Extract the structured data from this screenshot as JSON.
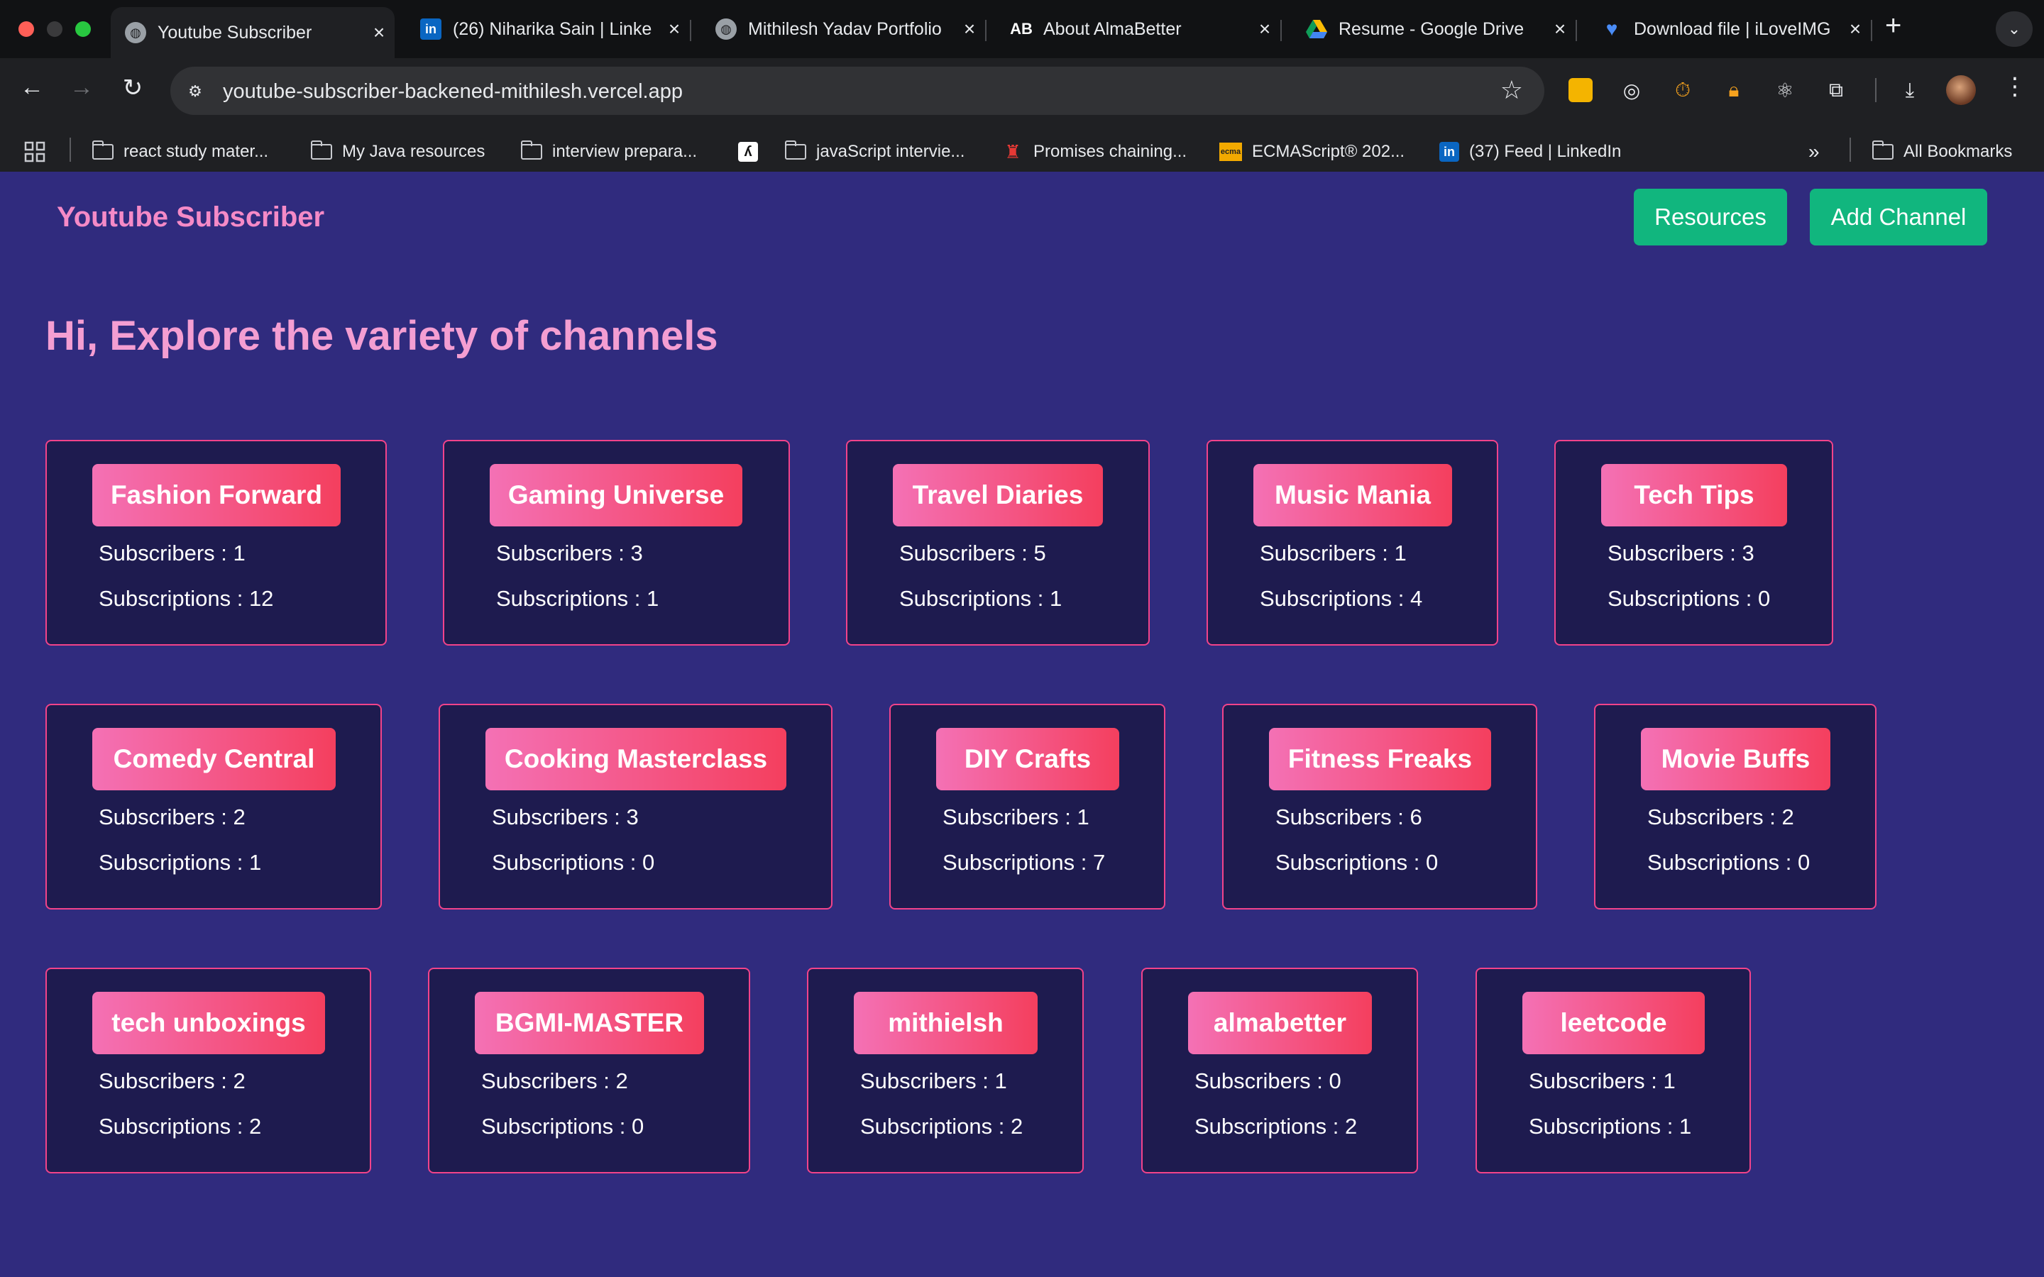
{
  "browser": {
    "tabs": [
      {
        "title": "Youtube Subscriber",
        "icon": "globe-icon"
      },
      {
        "title": "(26) Niharika Sain | Linke",
        "icon": "linkedin-icon"
      },
      {
        "title": "Mithilesh Yadav Portfolio",
        "icon": "globe-icon"
      },
      {
        "title": "About AlmaBetter",
        "icon": "almabetter-icon"
      },
      {
        "title": "Resume - Google Drive",
        "icon": "google-drive-icon"
      },
      {
        "title": "Download file | iLoveIMG",
        "icon": "heart-icon"
      }
    ],
    "url": "youtube-subscriber-backened-mithilesh.vercel.app",
    "bookmarks": [
      {
        "label": "react study mater...",
        "icon": "folder-icon"
      },
      {
        "label": "My Java resources",
        "icon": "folder-icon"
      },
      {
        "label": "interview prepara...",
        "icon": "folder-icon"
      },
      {
        "label": "",
        "icon": "bookmark-logo-icon"
      },
      {
        "label": "javaScript intervie...",
        "icon": "folder-icon"
      },
      {
        "label": "Promises chaining...",
        "icon": "tower-icon"
      },
      {
        "label": "ECMAScript® 202...",
        "icon": "ecma-icon"
      },
      {
        "label": "(37) Feed | LinkedIn",
        "icon": "linkedin-icon"
      }
    ],
    "more_bookmarks": "»",
    "all_bookmarks": "All Bookmarks"
  },
  "app": {
    "brand": "Youtube Subscriber",
    "resources_button": "Resources",
    "add_channel_button": "Add Channel",
    "heading": "Hi, Explore the variety of channels",
    "subscribers_label": "Subscribers : ",
    "subscriptions_label": "Subscriptions : "
  },
  "colors": {
    "page_background": "#302b7e",
    "card_background": "#1e1b4f",
    "card_border": "#f2438a",
    "accent_pink": "#f58ac7",
    "button_green": "#11b67e"
  },
  "channels": [
    {
      "name": "Fashion Forward",
      "subscribers": 1,
      "subscriptions": 12
    },
    {
      "name": "Gaming Universe",
      "subscribers": 3,
      "subscriptions": 1
    },
    {
      "name": "Travel Diaries",
      "subscribers": 5,
      "subscriptions": 1
    },
    {
      "name": "Music Mania",
      "subscribers": 1,
      "subscriptions": 4
    },
    {
      "name": "Tech Tips",
      "subscribers": 3,
      "subscriptions": 0
    },
    {
      "name": "Comedy Central",
      "subscribers": 2,
      "subscriptions": 1
    },
    {
      "name": "Cooking Masterclass",
      "subscribers": 3,
      "subscriptions": 0
    },
    {
      "name": "DIY Crafts",
      "subscribers": 1,
      "subscriptions": 7
    },
    {
      "name": "Fitness Freaks",
      "subscribers": 6,
      "subscriptions": 0
    },
    {
      "name": "Movie Buffs",
      "subscribers": 2,
      "subscriptions": 0
    },
    {
      "name": "tech unboxings",
      "subscribers": 2,
      "subscriptions": 2
    },
    {
      "name": "BGMI-MASTER",
      "subscribers": 2,
      "subscriptions": 0
    },
    {
      "name": "mithielsh",
      "subscribers": 1,
      "subscriptions": 2
    },
    {
      "name": "almabetter",
      "subscribers": 0,
      "subscriptions": 2
    },
    {
      "name": "leetcode",
      "subscribers": 1,
      "subscriptions": 1
    }
  ]
}
